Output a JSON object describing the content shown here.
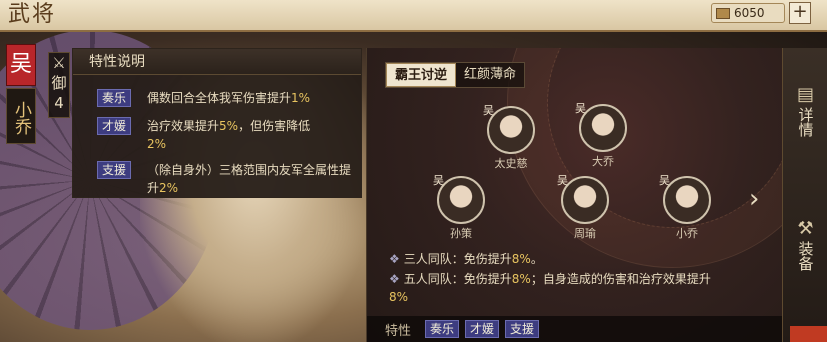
{
  "header": {
    "title": "武将",
    "currency_amount": "6050",
    "add_label": "+"
  },
  "hero": {
    "faction": "吴",
    "name": "小乔",
    "stat_label": "御",
    "stat_value": "4"
  },
  "trait_panel": {
    "title": "特性说明",
    "traits": [
      {
        "tag": "奏乐",
        "desc_parts": [
          "偶数回合全体我军伤害提升",
          "1%",
          ""
        ]
      },
      {
        "tag": "才媛",
        "desc_parts": [
          "治疗效果提升",
          "5%",
          "，但伤害降低",
          "2%"
        ]
      },
      {
        "tag": "支援",
        "desc_parts": [
          "（除自身外）三格范围内友军全属性提升",
          "2%"
        ]
      }
    ]
  },
  "team": {
    "tabs": [
      "霸王讨逆",
      "红颜薄命"
    ],
    "active_tab": 0,
    "members": [
      {
        "name": "太史慈",
        "faction": "吴"
      },
      {
        "name": "大乔",
        "faction": "吴"
      },
      {
        "name": "孙策",
        "faction": "吴"
      },
      {
        "name": "周瑜",
        "faction": "吴"
      },
      {
        "name": "小乔",
        "faction": "吴"
      }
    ],
    "bonuses": [
      {
        "prefix": "三人同队：免伤提升",
        "value": "8%",
        "suffix": "。"
      },
      {
        "prefix": "五人同队：免伤提升",
        "value": "8%",
        "mid": "；自身造成的伤害和治疗效果提升",
        "value2": "8%"
      }
    ],
    "trait_bar": {
      "label": "特性",
      "tags": [
        "奏乐",
        "才媛",
        "支援"
      ]
    },
    "next_label": "›"
  },
  "side_buttons": [
    {
      "label": "详情",
      "icon": "details-icon"
    },
    {
      "label": "装备",
      "icon": "equipment-icon"
    }
  ],
  "colors": {
    "highlight": "#e8c460",
    "trait_tag": "#3d3c80",
    "faction_red": "#b8262a"
  }
}
